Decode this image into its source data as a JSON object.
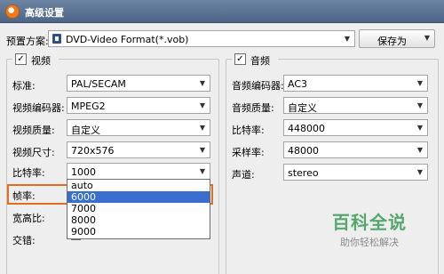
{
  "window": {
    "title": "高级设置"
  },
  "preset": {
    "label": "预置方案:",
    "value": "DVD-Video Format(*.vob)",
    "save_label": "保存为"
  },
  "video": {
    "legend": "视频",
    "checked": true,
    "fields": [
      {
        "label": "标准:",
        "value": "PAL/SECAM"
      },
      {
        "label": "视频编码器:",
        "value": "MPEG2"
      },
      {
        "label": "视频质量:",
        "value": "自定义"
      },
      {
        "label": "视频尺寸:",
        "value": "720x576"
      },
      {
        "label": "比特率:",
        "value": "1000"
      }
    ],
    "extra_labels": [
      "帧率:",
      "宽高比:",
      "交错:"
    ],
    "bitrate_options": [
      "auto",
      "6000",
      "7000",
      "8000",
      "9000"
    ],
    "bitrate_selected": "6000"
  },
  "audio": {
    "legend": "音频",
    "checked": true,
    "fields": [
      {
        "label": "音频编码器:",
        "value": "AC3"
      },
      {
        "label": "音频质量:",
        "value": "自定义"
      },
      {
        "label": "比特率:",
        "value": "448000"
      },
      {
        "label": "采样率:",
        "value": "48000"
      },
      {
        "label": "声道:",
        "value": "stereo"
      }
    ]
  },
  "watermark": {
    "main": "百科全说",
    "sub": "助你轻松解决"
  },
  "colors": {
    "highlight": "#e56b1f",
    "selection": "#3a6fd0",
    "watermark": "#55a76e"
  },
  "icons": {
    "app": "app-logo-icon",
    "preset": "film-icon",
    "dropdown": "chevron-down-icon",
    "checkbox": "checkbox-checked-icon"
  }
}
